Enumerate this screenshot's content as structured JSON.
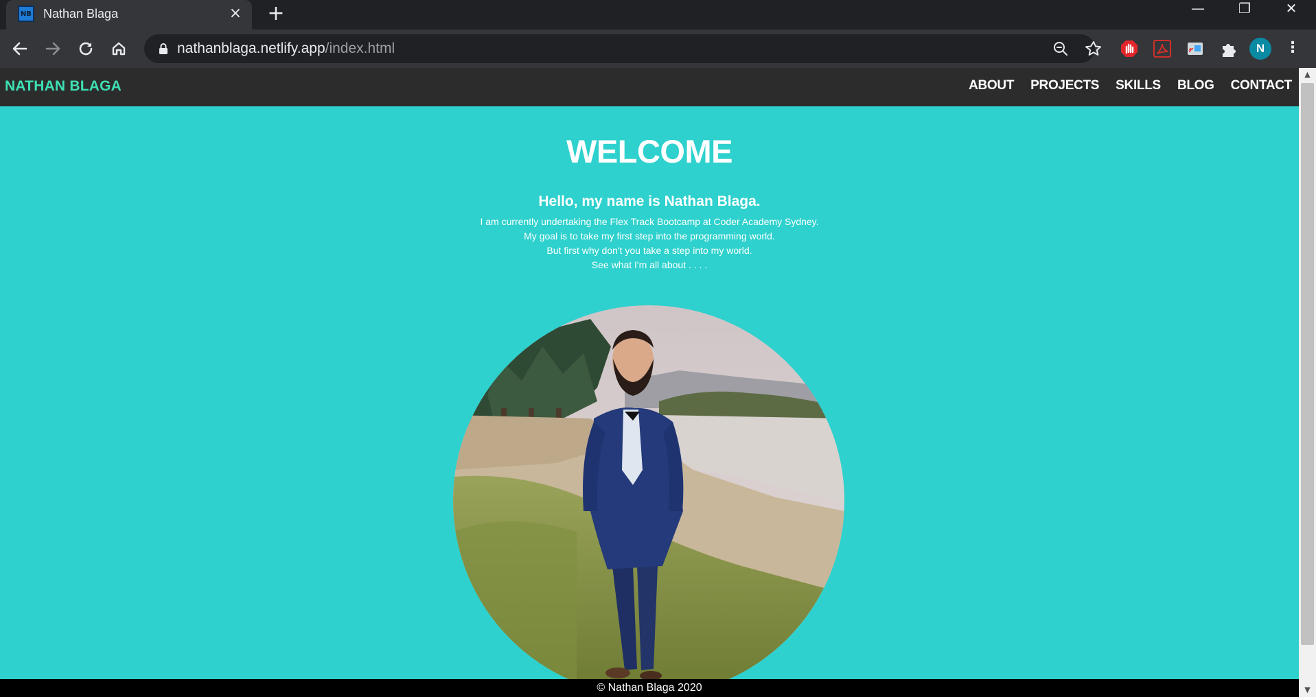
{
  "browser": {
    "tab": {
      "favicon_text": "NB",
      "title": "Nathan Blaga"
    },
    "window_controls": {
      "minimize": "—",
      "restore": "❐",
      "close": "✕"
    },
    "url": {
      "domain": "nathanblaga.netlify.app",
      "path": "/index.html"
    },
    "profile_initial": "N"
  },
  "site": {
    "brand": "NATHAN BLAGA",
    "nav": [
      "ABOUT",
      "PROJECTS",
      "SKILLS",
      "BLOG",
      "CONTACT"
    ],
    "heading": "WELCOME",
    "greeting": "Hello, my name is Nathan Blaga.",
    "intro_lines": [
      "I am currently undertaking the Flex Track Bootcamp at Coder Academy Sydney.",
      "My goal is to take my first step into the programming world.",
      "But first why don't you take a step into my world.",
      "See what I'm all about . . . ."
    ],
    "footer": "© Nathan Blaga 2020"
  },
  "colors": {
    "page_bg": "#2ed1cd",
    "nav_bg": "#2c2c2c",
    "brand": "#3ee0b4",
    "footer_bg": "#000000"
  }
}
